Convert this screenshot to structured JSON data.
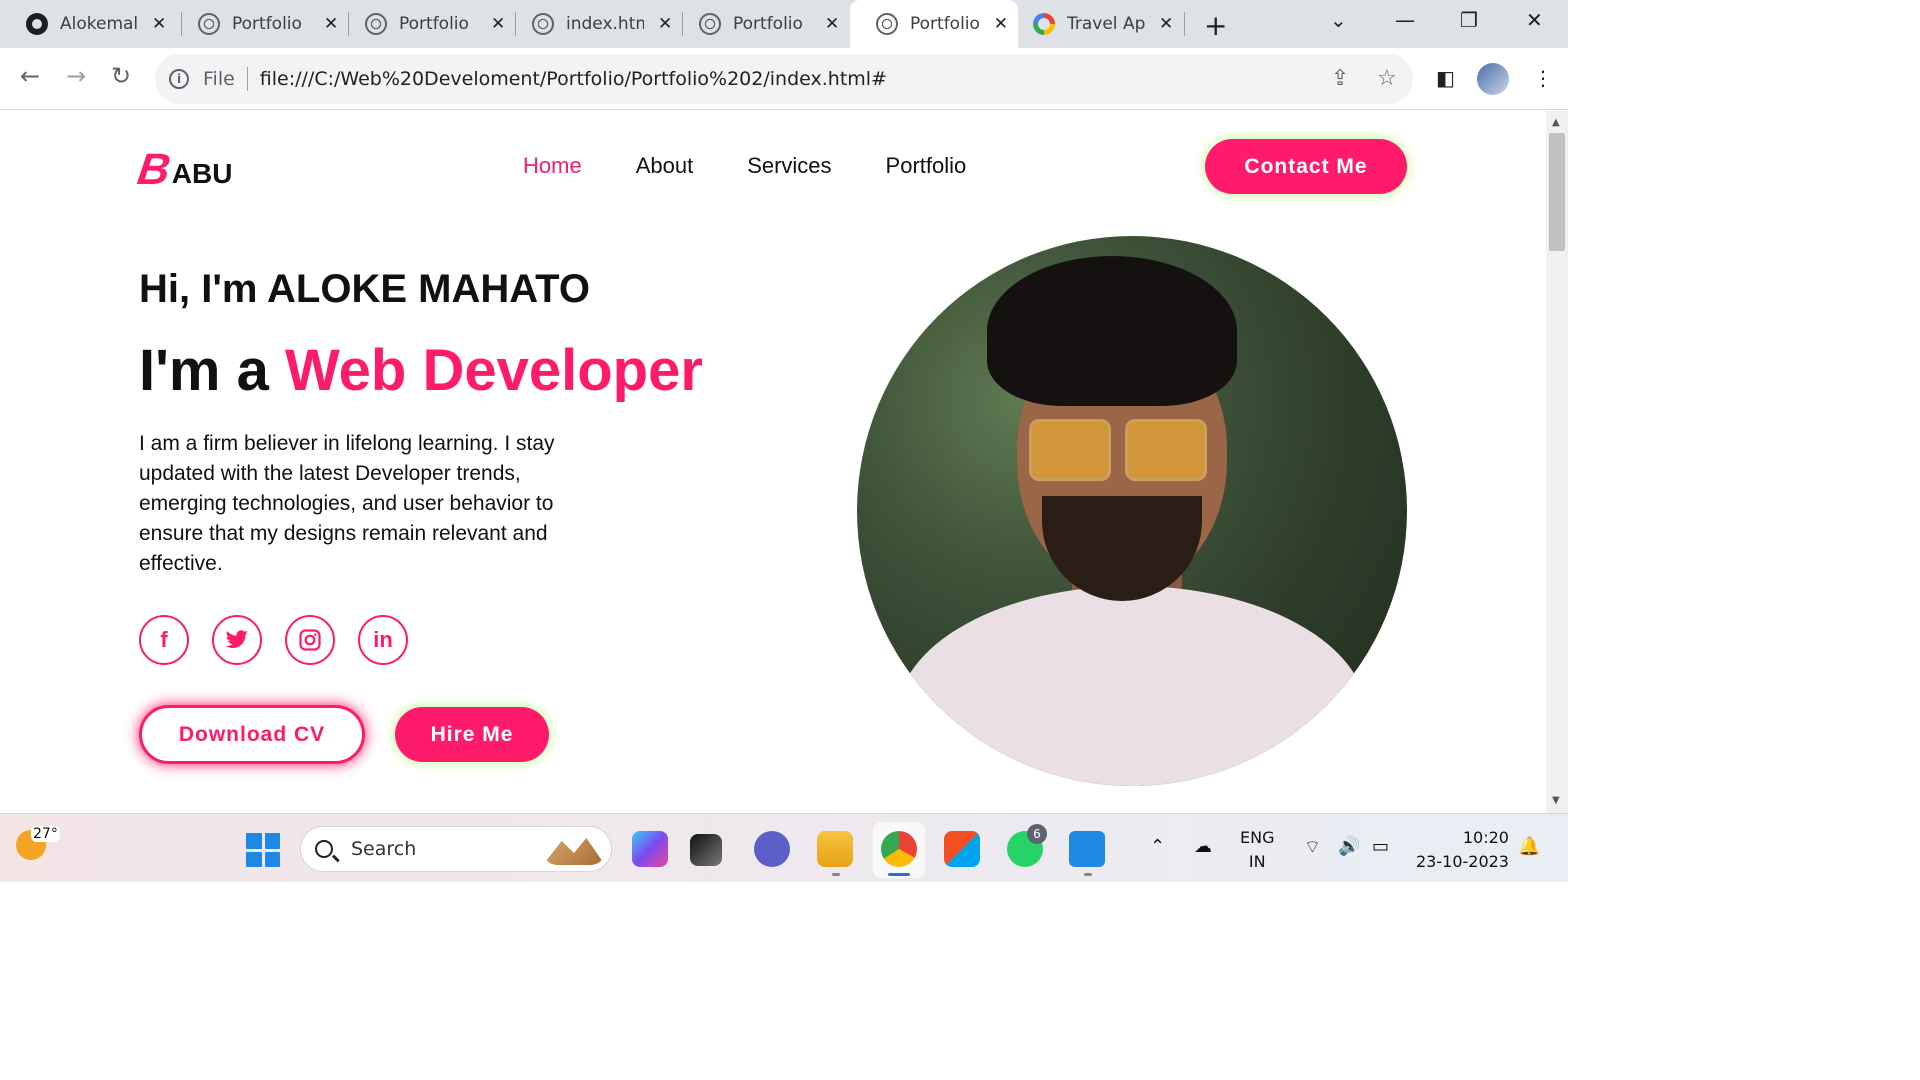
{
  "browser": {
    "tabs": [
      {
        "title": "Alokemal",
        "icon": "github-icon"
      },
      {
        "title": "Portfolio",
        "icon": "globe-icon"
      },
      {
        "title": "Portfolio",
        "icon": "globe-icon"
      },
      {
        "title": "index.htm",
        "icon": "globe-icon"
      },
      {
        "title": "Portfolio",
        "icon": "globe-icon"
      },
      {
        "title": "Portfolio",
        "icon": "globe-icon",
        "active": true
      },
      {
        "title": "Travel Ap",
        "icon": "google-icon"
      }
    ],
    "new_tab": "+",
    "close_glyph": "✕",
    "window_controls": {
      "tab_search": "⌄",
      "minimize": "—",
      "maximize": "❐",
      "close": "✕"
    },
    "address": {
      "info": "i",
      "scheme_label": "File",
      "url": "file:///C:/Web%20Develoment/Portfolio/Portfolio%202/index.html#"
    }
  },
  "site": {
    "logo": {
      "mark": "B",
      "text": "ABU"
    },
    "nav": [
      "Home",
      "About",
      "Services",
      "Portfolio"
    ],
    "nav_active": "Home",
    "contact_button": "Contact Me",
    "hero": {
      "greeting": "Hi, I'm ALOKE MAHATO",
      "im_prefix": "I'm a",
      "role": "Web Developer",
      "bio": "I am a firm believer in lifelong learning. I stay updated with the latest Developer trends, emerging technologies, and user behavior to ensure that my designs remain relevant and effective.",
      "socials": [
        {
          "name": "facebook-icon",
          "glyph": "f"
        },
        {
          "name": "twitter-icon",
          "glyph": "🐦"
        },
        {
          "name": "instagram-icon",
          "glyph": "◎"
        },
        {
          "name": "linkedin-icon",
          "glyph": "in"
        }
      ],
      "download_cv": "Download CV",
      "hire_me": "Hire Me"
    },
    "colors": {
      "accent": "#ff1b6b",
      "button_glow": "#b6f58a",
      "text": "#111111"
    }
  },
  "taskbar": {
    "weather_temp": "27°",
    "search_placeholder": "Search",
    "whatsapp_badge": "6",
    "language": "ENG",
    "region": "IN",
    "time": "10:20",
    "date": "23-10-2023"
  }
}
